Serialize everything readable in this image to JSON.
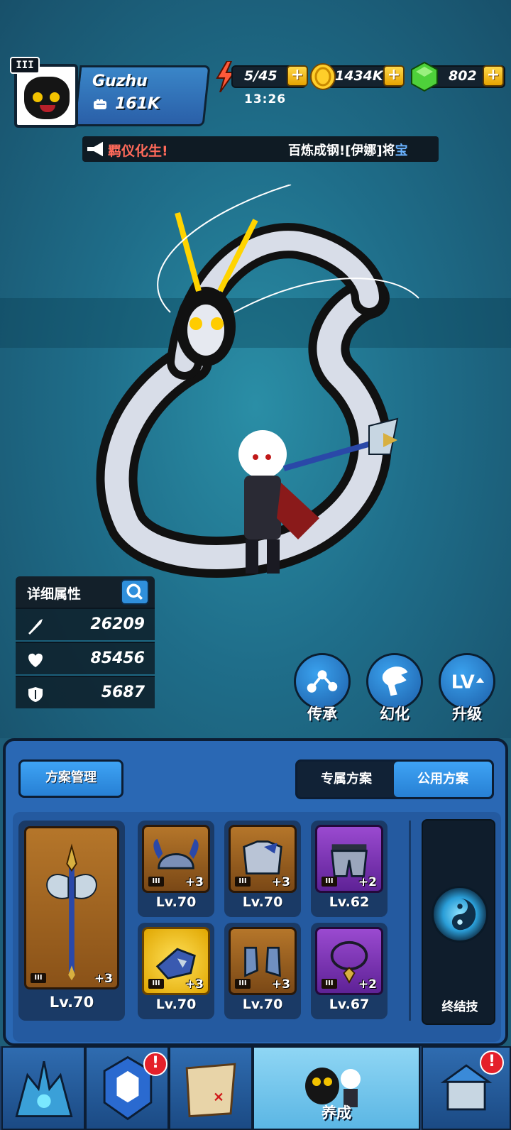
{
  "player": {
    "rank_badge": "III",
    "name": "Guzhu",
    "power": "161K"
  },
  "resources": {
    "stamina": "5/45",
    "stamina_timer": "13:26",
    "gold": "1434K",
    "gems": "802",
    "plus": "+"
  },
  "ticker": {
    "msg1": "羁仪化生!",
    "msg2": "百炼成钢![伊娜]将",
    "msg2_tail": "宝"
  },
  "stats": {
    "title": "详细属性",
    "attack": "26209",
    "hp": "85456",
    "defense": "5687"
  },
  "actions": [
    {
      "label": "传承",
      "icon": "inherit-icon"
    },
    {
      "label": "幻化",
      "icon": "transform-icon"
    },
    {
      "label": "升级",
      "icon": "level-up-icon"
    }
  ],
  "panel": {
    "plan_manage": "方案管理",
    "tab_exclusive": "专属方案",
    "tab_public": "公用方案",
    "ultimate": "终结技"
  },
  "equipment": {
    "weapon": {
      "rarity": "III",
      "plus": "+3",
      "level": "Lv.70"
    },
    "slots": [
      {
        "name": "helmet",
        "rarity": "III",
        "plus": "+3",
        "level": "Lv.70",
        "tier": "orange"
      },
      {
        "name": "armor",
        "rarity": "III",
        "plus": "+3",
        "level": "Lv.70",
        "tier": "orange"
      },
      {
        "name": "pants",
        "rarity": "III",
        "plus": "+2",
        "level": "Lv.62",
        "tier": "purple"
      },
      {
        "name": "gauntlet",
        "rarity": "III",
        "plus": "+3",
        "level": "Lv.70",
        "tier": "gold"
      },
      {
        "name": "boots",
        "rarity": "III",
        "plus": "+3",
        "level": "Lv.70",
        "tier": "orange"
      },
      {
        "name": "necklace",
        "rarity": "III",
        "plus": "+2",
        "level": "Lv.67",
        "tier": "purple"
      }
    ]
  },
  "nav": {
    "items": [
      {
        "name": "nav-castle",
        "label": ""
      },
      {
        "name": "nav-cards",
        "label": "",
        "badge": "!"
      },
      {
        "name": "nav-map",
        "label": ""
      },
      {
        "name": "nav-train",
        "label": "养成"
      },
      {
        "name": "nav-shop",
        "label": "",
        "badge": "!"
      }
    ]
  },
  "colors": {
    "background": "#1f6e8a",
    "panel": "#2a68b4",
    "accent": "#3ea3f4",
    "gold": "#ffd84a",
    "alert": "#e4202a"
  }
}
